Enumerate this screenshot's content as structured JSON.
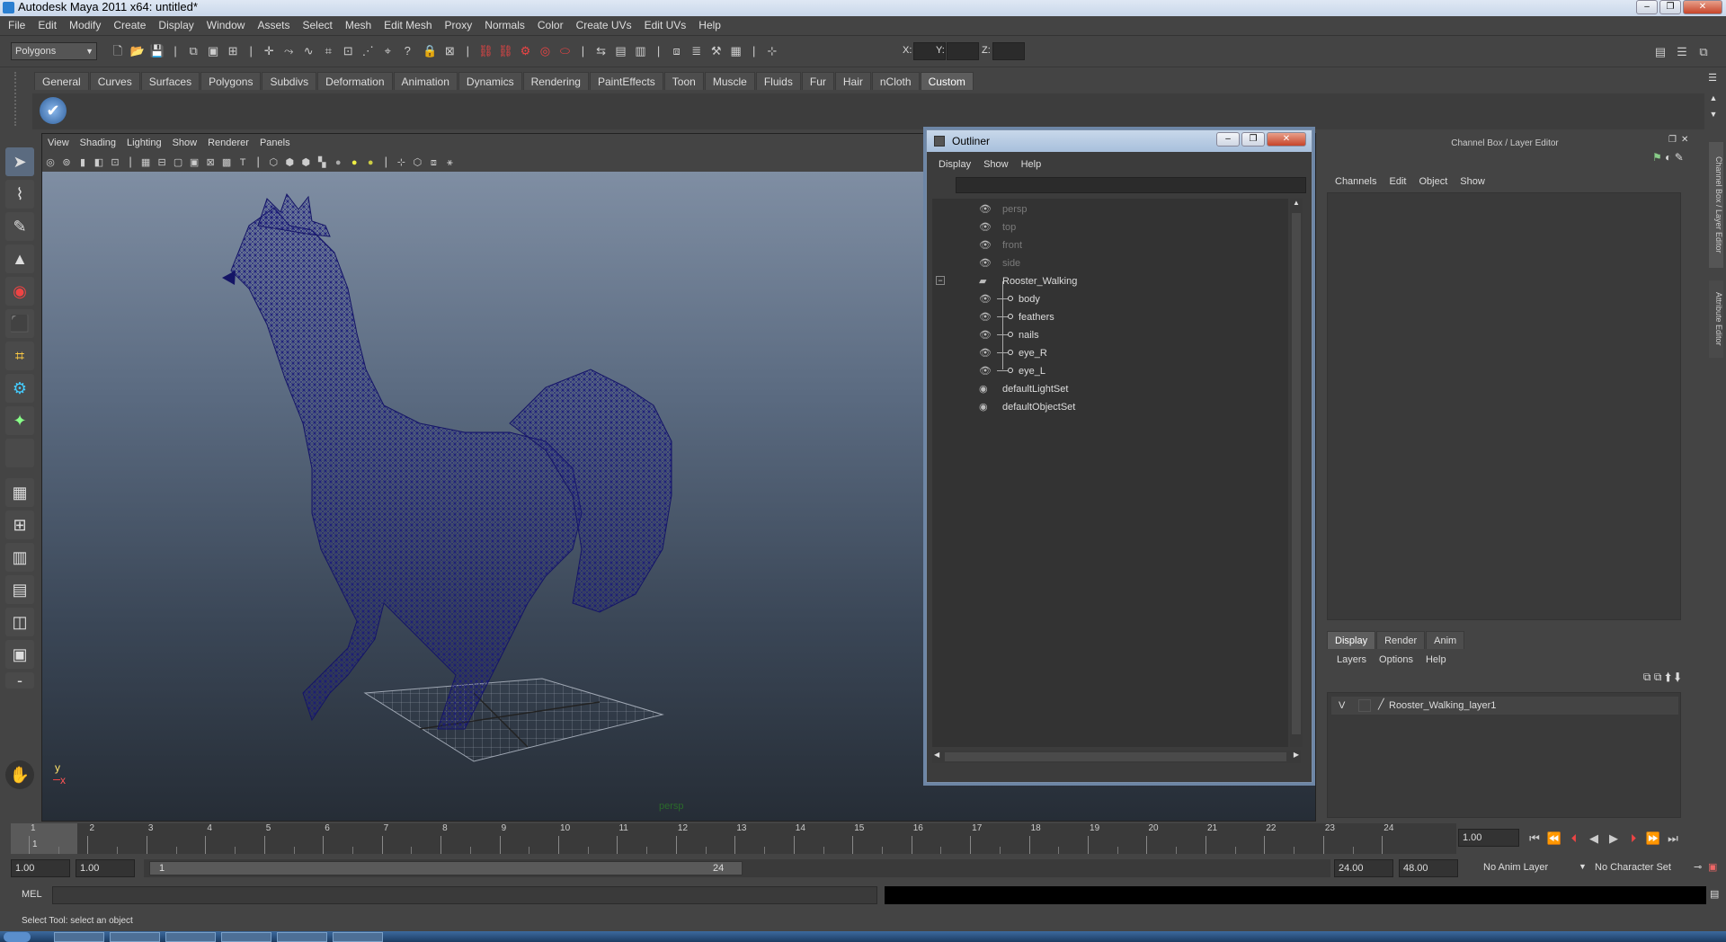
{
  "window": {
    "title": "Autodesk Maya 2011 x64: untitled*"
  },
  "menubar": [
    "File",
    "Edit",
    "Modify",
    "Create",
    "Display",
    "Window",
    "Assets",
    "Select",
    "Mesh",
    "Edit Mesh",
    "Proxy",
    "Normals",
    "Color",
    "Create UVs",
    "Edit UVs",
    "Help"
  ],
  "statusline": {
    "mode": "Polygons",
    "x_label": "X:",
    "y_label": "Y:",
    "z_label": "Z:"
  },
  "shelf": {
    "tabs": [
      "General",
      "Curves",
      "Surfaces",
      "Polygons",
      "Subdivs",
      "Deformation",
      "Animation",
      "Dynamics",
      "Rendering",
      "PaintEffects",
      "Toon",
      "Muscle",
      "Fluids",
      "Fur",
      "Hair",
      "nCloth",
      "Custom"
    ],
    "active": "Custom"
  },
  "viewport": {
    "menu": [
      "View",
      "Shading",
      "Lighting",
      "Show",
      "Renderer",
      "Panels"
    ],
    "camera_label": "persp",
    "axis_y": "y",
    "axis_x": "x"
  },
  "outliner": {
    "title": "Outliner",
    "menu": [
      "Display",
      "Show",
      "Help"
    ],
    "items": [
      {
        "name": "persp",
        "dim": true,
        "indent": 0
      },
      {
        "name": "top",
        "dim": true,
        "indent": 0
      },
      {
        "name": "front",
        "dim": true,
        "indent": 0
      },
      {
        "name": "side",
        "dim": true,
        "indent": 0
      },
      {
        "name": "Rooster_Walking",
        "dim": false,
        "indent": 0,
        "expanded": true
      },
      {
        "name": "body",
        "dim": false,
        "indent": 1
      },
      {
        "name": "feathers",
        "dim": false,
        "indent": 1
      },
      {
        "name": "nails",
        "dim": false,
        "indent": 1
      },
      {
        "name": "eye_R",
        "dim": false,
        "indent": 1
      },
      {
        "name": "eye_L",
        "dim": false,
        "indent": 1
      },
      {
        "name": "defaultLightSet",
        "dim": false,
        "indent": 0,
        "set": true
      },
      {
        "name": "defaultObjectSet",
        "dim": false,
        "indent": 0,
        "set": true
      }
    ]
  },
  "channelbox": {
    "title": "Channel Box / Layer Editor",
    "menu": [
      "Channels",
      "Edit",
      "Object",
      "Show"
    ],
    "layer_tabs": [
      "Display",
      "Render",
      "Anim"
    ],
    "layer_menu": [
      "Layers",
      "Options",
      "Help"
    ],
    "layer": {
      "visible": "V",
      "name": "Rooster_Walking_layer1"
    },
    "side_tabs": [
      "Channel Box / Layer Editor",
      "Attribute Editor"
    ]
  },
  "timeslider": {
    "ticks": [
      "1",
      "2",
      "3",
      "4",
      "5",
      "6",
      "7",
      "8",
      "9",
      "10",
      "11",
      "12",
      "13",
      "14",
      "15",
      "16",
      "17",
      "18",
      "19",
      "20",
      "21",
      "22",
      "23",
      "24"
    ],
    "current_frame_marker": "1",
    "current_time": "1.00"
  },
  "rangeslider": {
    "start": "1.00",
    "start2": "1.00",
    "range_start": "1",
    "range_end": "24",
    "end": "24.00",
    "end2": "48.00",
    "anim_layer": "No Anim Layer",
    "char_set": "No Character Set"
  },
  "cmdline": {
    "label": "MEL"
  },
  "helpline": {
    "text": "Select Tool: select an object"
  }
}
